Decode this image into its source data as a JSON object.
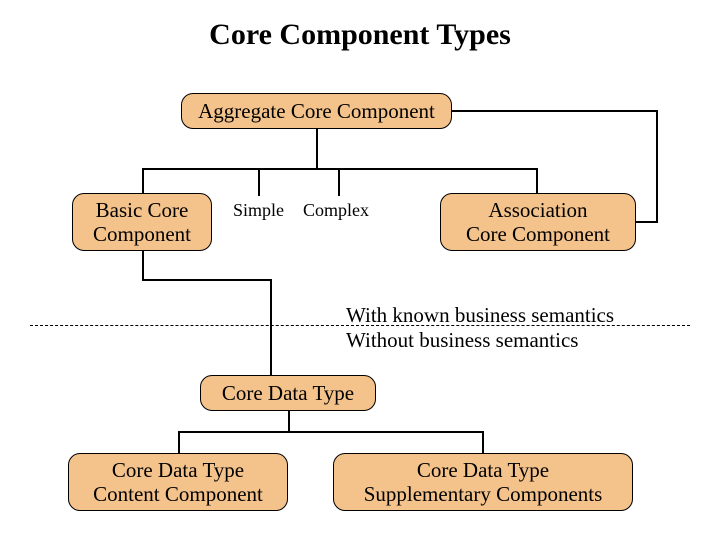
{
  "title": "Core Component Types",
  "boxes": {
    "aggregate": "Aggregate Core Component",
    "basic": "Basic Core\nComponent",
    "association": "Association\nCore Component",
    "coreDataType": "Core Data Type",
    "content": "Core Data Type\nContent Component",
    "supplementary": "Core Data Type\nSupplementary Components"
  },
  "labels": {
    "simple": "Simple",
    "complex": "Complex"
  },
  "semantics": {
    "with": "With known business semantics",
    "without": "Without business semantics"
  }
}
